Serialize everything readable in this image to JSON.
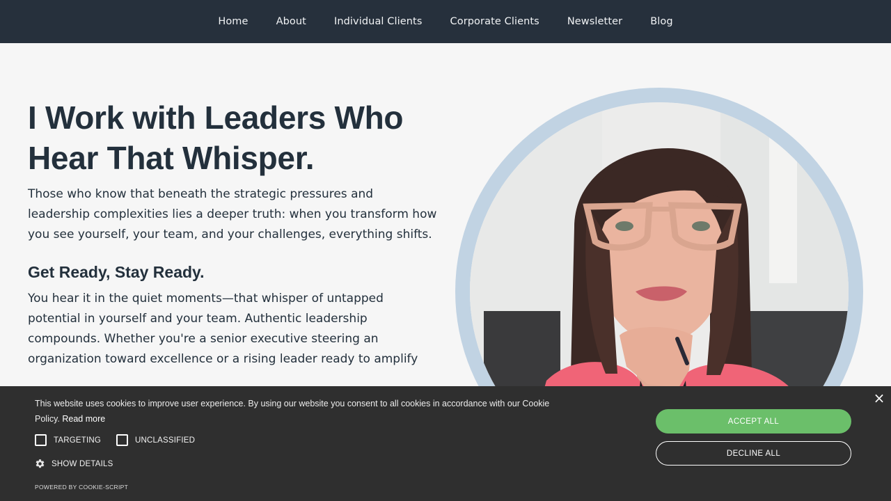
{
  "nav": {
    "items": [
      {
        "label": "Home"
      },
      {
        "label": "About"
      },
      {
        "label": "Individual Clients"
      },
      {
        "label": "Corporate Clients"
      },
      {
        "label": "Newsletter"
      },
      {
        "label": "Blog"
      }
    ]
  },
  "hero": {
    "heading_line1": "I Work with Leaders Who",
    "heading_line2": "Hear That Whisper.",
    "intro": "Those who know that beneath the strategic pressures and leadership complexities lies a deeper truth: when you transform how you see yourself, your team, and your challenges, everything shifts.",
    "subheading": "Get Ready, Stay Ready.",
    "body": "You hear it in the quiet moments—that whisper of untapped potential in yourself and your team. Authentic leadership compounds. Whether you're a senior executive steering an organization toward excellence or a rising leader ready to amplify"
  },
  "portrait": {
    "ring_color": "#c1d3e3"
  },
  "cookie": {
    "message": "This website uses cookies to improve user experience. By using our website you consent to all cookies in accordance with our Cookie Policy.",
    "read_more": "Read more",
    "options": [
      {
        "label": "TARGETING",
        "checked": false
      },
      {
        "label": "UNCLASSIFIED",
        "checked": false
      }
    ],
    "show_details": "SHOW DETAILS",
    "powered_by": "POWERED BY COOKIE-SCRIPT",
    "accept_label": "ACCEPT ALL",
    "decline_label": "DECLINE ALL",
    "close_glyph": "×",
    "accept_color": "#6bbf6a"
  },
  "colors": {
    "nav_bg": "#26303c",
    "text_dark": "#23303c",
    "page_bg": "#f6f6f6",
    "cookie_bg": "#2f2f2f"
  }
}
